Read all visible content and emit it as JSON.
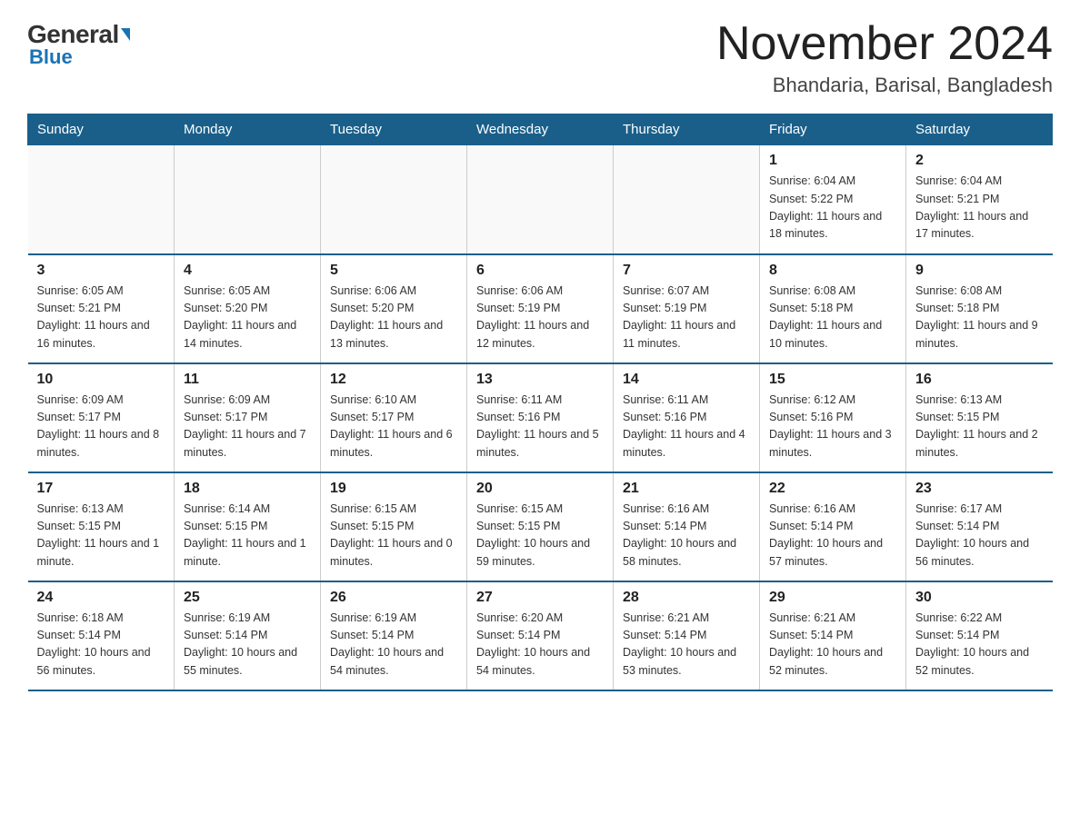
{
  "logo": {
    "general": "General",
    "blue": "Blue"
  },
  "title": "November 2024",
  "location": "Bhandaria, Barisal, Bangladesh",
  "weekdays": [
    "Sunday",
    "Monday",
    "Tuesday",
    "Wednesday",
    "Thursday",
    "Friday",
    "Saturday"
  ],
  "weeks": [
    [
      {
        "day": "",
        "info": ""
      },
      {
        "day": "",
        "info": ""
      },
      {
        "day": "",
        "info": ""
      },
      {
        "day": "",
        "info": ""
      },
      {
        "day": "",
        "info": ""
      },
      {
        "day": "1",
        "info": "Sunrise: 6:04 AM\nSunset: 5:22 PM\nDaylight: 11 hours and 18 minutes."
      },
      {
        "day": "2",
        "info": "Sunrise: 6:04 AM\nSunset: 5:21 PM\nDaylight: 11 hours and 17 minutes."
      }
    ],
    [
      {
        "day": "3",
        "info": "Sunrise: 6:05 AM\nSunset: 5:21 PM\nDaylight: 11 hours and 16 minutes."
      },
      {
        "day": "4",
        "info": "Sunrise: 6:05 AM\nSunset: 5:20 PM\nDaylight: 11 hours and 14 minutes."
      },
      {
        "day": "5",
        "info": "Sunrise: 6:06 AM\nSunset: 5:20 PM\nDaylight: 11 hours and 13 minutes."
      },
      {
        "day": "6",
        "info": "Sunrise: 6:06 AM\nSunset: 5:19 PM\nDaylight: 11 hours and 12 minutes."
      },
      {
        "day": "7",
        "info": "Sunrise: 6:07 AM\nSunset: 5:19 PM\nDaylight: 11 hours and 11 minutes."
      },
      {
        "day": "8",
        "info": "Sunrise: 6:08 AM\nSunset: 5:18 PM\nDaylight: 11 hours and 10 minutes."
      },
      {
        "day": "9",
        "info": "Sunrise: 6:08 AM\nSunset: 5:18 PM\nDaylight: 11 hours and 9 minutes."
      }
    ],
    [
      {
        "day": "10",
        "info": "Sunrise: 6:09 AM\nSunset: 5:17 PM\nDaylight: 11 hours and 8 minutes."
      },
      {
        "day": "11",
        "info": "Sunrise: 6:09 AM\nSunset: 5:17 PM\nDaylight: 11 hours and 7 minutes."
      },
      {
        "day": "12",
        "info": "Sunrise: 6:10 AM\nSunset: 5:17 PM\nDaylight: 11 hours and 6 minutes."
      },
      {
        "day": "13",
        "info": "Sunrise: 6:11 AM\nSunset: 5:16 PM\nDaylight: 11 hours and 5 minutes."
      },
      {
        "day": "14",
        "info": "Sunrise: 6:11 AM\nSunset: 5:16 PM\nDaylight: 11 hours and 4 minutes."
      },
      {
        "day": "15",
        "info": "Sunrise: 6:12 AM\nSunset: 5:16 PM\nDaylight: 11 hours and 3 minutes."
      },
      {
        "day": "16",
        "info": "Sunrise: 6:13 AM\nSunset: 5:15 PM\nDaylight: 11 hours and 2 minutes."
      }
    ],
    [
      {
        "day": "17",
        "info": "Sunrise: 6:13 AM\nSunset: 5:15 PM\nDaylight: 11 hours and 1 minute."
      },
      {
        "day": "18",
        "info": "Sunrise: 6:14 AM\nSunset: 5:15 PM\nDaylight: 11 hours and 1 minute."
      },
      {
        "day": "19",
        "info": "Sunrise: 6:15 AM\nSunset: 5:15 PM\nDaylight: 11 hours and 0 minutes."
      },
      {
        "day": "20",
        "info": "Sunrise: 6:15 AM\nSunset: 5:15 PM\nDaylight: 10 hours and 59 minutes."
      },
      {
        "day": "21",
        "info": "Sunrise: 6:16 AM\nSunset: 5:14 PM\nDaylight: 10 hours and 58 minutes."
      },
      {
        "day": "22",
        "info": "Sunrise: 6:16 AM\nSunset: 5:14 PM\nDaylight: 10 hours and 57 minutes."
      },
      {
        "day": "23",
        "info": "Sunrise: 6:17 AM\nSunset: 5:14 PM\nDaylight: 10 hours and 56 minutes."
      }
    ],
    [
      {
        "day": "24",
        "info": "Sunrise: 6:18 AM\nSunset: 5:14 PM\nDaylight: 10 hours and 56 minutes."
      },
      {
        "day": "25",
        "info": "Sunrise: 6:19 AM\nSunset: 5:14 PM\nDaylight: 10 hours and 55 minutes."
      },
      {
        "day": "26",
        "info": "Sunrise: 6:19 AM\nSunset: 5:14 PM\nDaylight: 10 hours and 54 minutes."
      },
      {
        "day": "27",
        "info": "Sunrise: 6:20 AM\nSunset: 5:14 PM\nDaylight: 10 hours and 54 minutes."
      },
      {
        "day": "28",
        "info": "Sunrise: 6:21 AM\nSunset: 5:14 PM\nDaylight: 10 hours and 53 minutes."
      },
      {
        "day": "29",
        "info": "Sunrise: 6:21 AM\nSunset: 5:14 PM\nDaylight: 10 hours and 52 minutes."
      },
      {
        "day": "30",
        "info": "Sunrise: 6:22 AM\nSunset: 5:14 PM\nDaylight: 10 hours and 52 minutes."
      }
    ]
  ]
}
